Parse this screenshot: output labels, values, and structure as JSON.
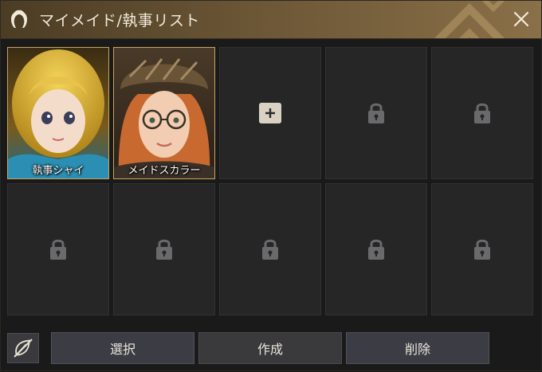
{
  "window": {
    "title": "マイメイド/執事リスト",
    "title_icon": "maid-icon",
    "close_icon": "close-icon"
  },
  "slots": [
    {
      "state": "filled",
      "name": "執事シャイ",
      "portrait": "butler-portrait"
    },
    {
      "state": "filled",
      "name": "メイドスカラー",
      "portrait": "maid-portrait"
    },
    {
      "state": "add",
      "icon": "plus-icon"
    },
    {
      "state": "locked",
      "icon": "lock-icon"
    },
    {
      "state": "locked",
      "icon": "lock-icon"
    },
    {
      "state": "locked",
      "icon": "lock-icon"
    },
    {
      "state": "locked",
      "icon": "lock-icon"
    },
    {
      "state": "locked",
      "icon": "lock-icon"
    },
    {
      "state": "locked",
      "icon": "lock-icon"
    },
    {
      "state": "locked",
      "icon": "lock-icon"
    }
  ],
  "footer": {
    "toggle_icon": "hide-toggle-icon",
    "select_label": "選択",
    "create_label": "作成",
    "delete_label": "削除"
  },
  "colors": {
    "title_bar": "#6a5535",
    "slot_border_selected": "#c8a45e",
    "slot_bg": "#262627",
    "button_bg": "#3c3d44"
  }
}
